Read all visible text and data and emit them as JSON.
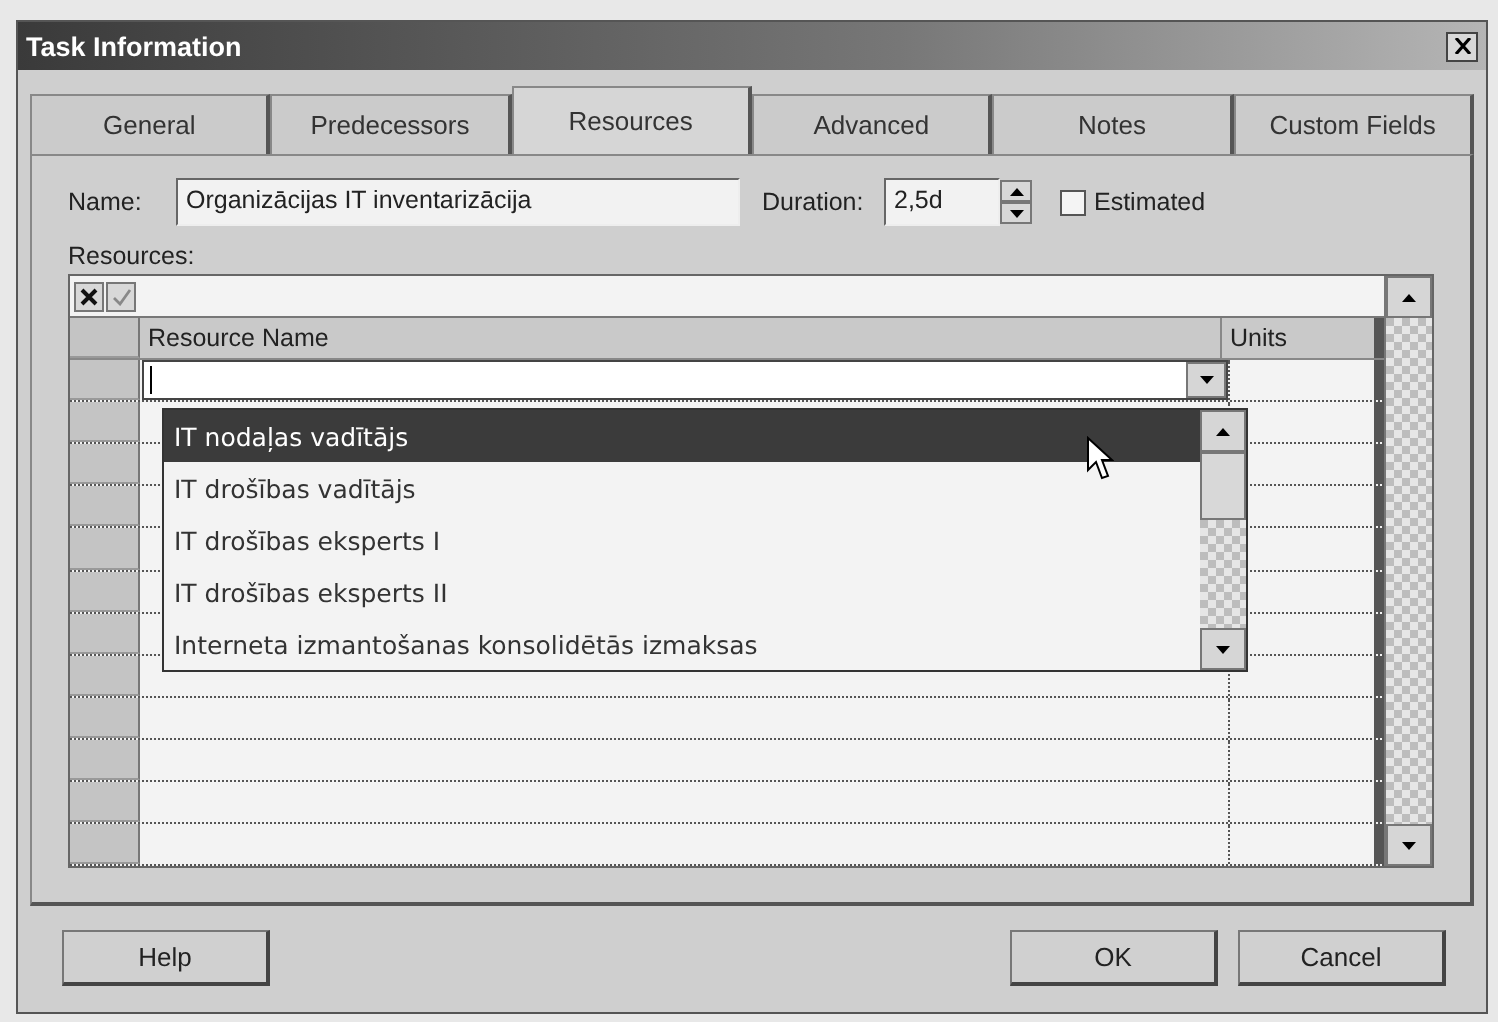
{
  "window": {
    "title": "Task Information"
  },
  "tabs": [
    {
      "label": "General",
      "selected": false
    },
    {
      "label": "Predecessors",
      "selected": false
    },
    {
      "label": "Resources",
      "selected": true
    },
    {
      "label": "Advanced",
      "selected": false
    },
    {
      "label": "Notes",
      "selected": false
    },
    {
      "label": "Custom Fields",
      "selected": false
    }
  ],
  "name_field": {
    "label": "Name:",
    "value": "Organizācijas IT inventarizācija"
  },
  "duration_field": {
    "label": "Duration:",
    "value": "2,5d"
  },
  "estimated": {
    "label": "Estimated",
    "checked": false
  },
  "resources": {
    "label": "Resources:",
    "columns": [
      "Resource Name",
      "Units"
    ]
  },
  "dropdown": {
    "items": [
      {
        "label": "IT nodaļas vadītājs",
        "selected": true
      },
      {
        "label": "IT drošības vadītājs",
        "selected": false
      },
      {
        "label": "IT drošības eksperts I",
        "selected": false
      },
      {
        "label": "IT drošības eksperts II",
        "selected": false
      },
      {
        "label": "Interneta izmantošanas konsolidētās izmaksas",
        "selected": false
      }
    ]
  },
  "buttons": [
    {
      "label": "Help"
    },
    {
      "label": "OK"
    },
    {
      "label": "Cancel"
    }
  ]
}
